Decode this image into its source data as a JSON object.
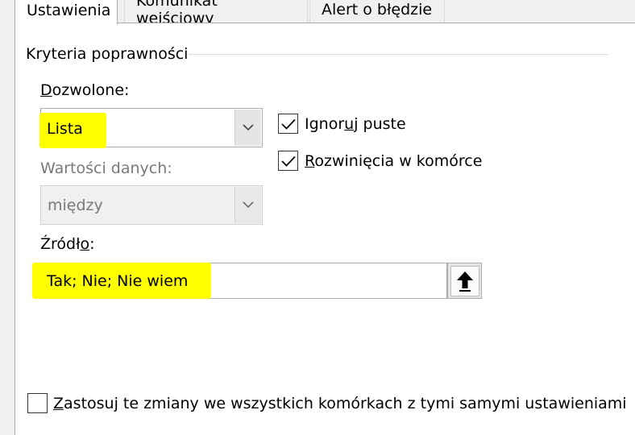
{
  "tabs": [
    {
      "label": "Ustawienia"
    },
    {
      "label": "Komunikat wejściowy"
    },
    {
      "label": "Alert o błędzie"
    }
  ],
  "group": {
    "title": "Kryteria poprawności"
  },
  "allow": {
    "label_first": "D",
    "label_rest": "ozwolone:",
    "value": "Lista"
  },
  "data_field": {
    "label": "Wartości danych:",
    "value": "między"
  },
  "ignore_blank": {
    "label_before": "Ignor",
    "label_key": "u",
    "label_after": "j puste",
    "checked": true
  },
  "in_cell_dropdown": {
    "label_key": "R",
    "label_rest": "ozwinięcia w komórce",
    "checked": true
  },
  "source": {
    "label_before": "Źródł",
    "label_key": "o",
    "label_after": ":",
    "value": "Tak; Nie; Nie wiem"
  },
  "apply_all": {
    "label_key": "Z",
    "label_rest": "astosuj te zmiany we wszystkich komórkach z tymi samymi ustawieniami",
    "checked": false
  },
  "colors": {
    "highlight": "#ffff00",
    "panel": "#ffffff",
    "background": "#f0f0f0"
  },
  "icons": {
    "dropdown": "chevron-down-icon",
    "collapse": "arrow-up-icon",
    "check": "checkmark-icon"
  }
}
